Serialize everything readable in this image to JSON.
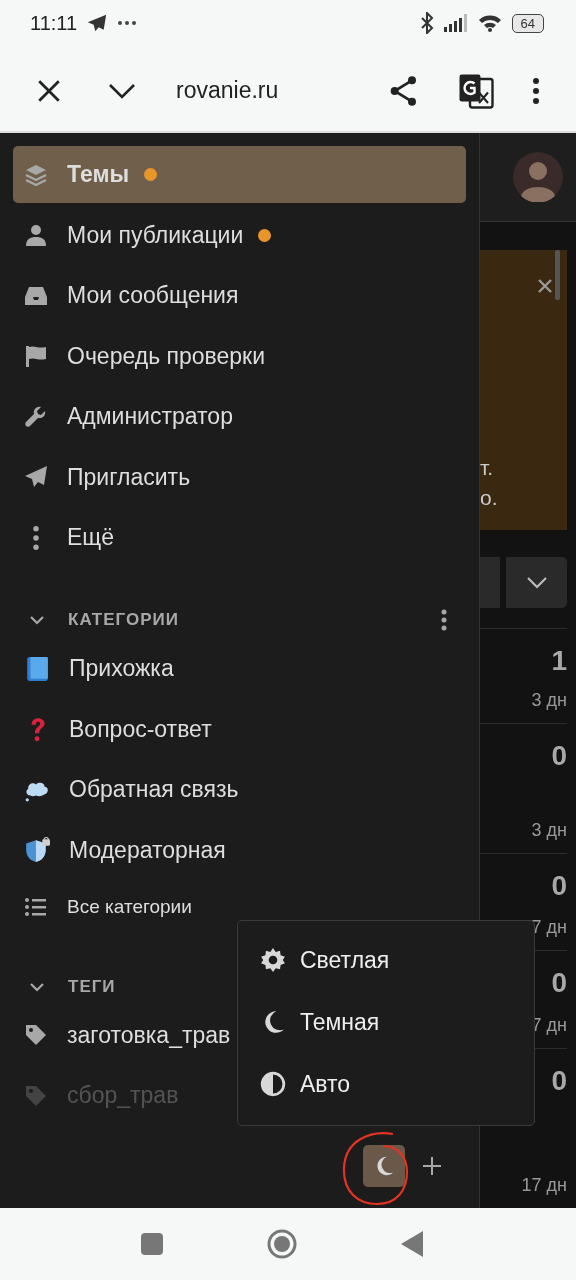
{
  "status_bar": {
    "time": "11:11",
    "battery": "64"
  },
  "browser_bar": {
    "url": "rovanie.ru"
  },
  "sidebar": {
    "nav": [
      {
        "label": "Темы",
        "dot": true,
        "selected": true
      },
      {
        "label": "Мои публикации",
        "dot": true,
        "selected": false
      },
      {
        "label": "Мои сообщения",
        "dot": false,
        "selected": false
      },
      {
        "label": "Очередь проверки",
        "dot": false,
        "selected": false
      },
      {
        "label": "Администратор",
        "dot": false,
        "selected": false
      },
      {
        "label": "Пригласить",
        "dot": false,
        "selected": false
      },
      {
        "label": "Ещё",
        "dot": false,
        "selected": false
      }
    ],
    "categories": {
      "title": "КАТЕГОРИИ",
      "expanded": true,
      "items": [
        {
          "label": "Прихожка"
        },
        {
          "label": "Вопрос-ответ"
        },
        {
          "label": "Обратная связь"
        },
        {
          "label": "Модераторная"
        }
      ],
      "all_label": "Все категории"
    },
    "tags": {
      "title": "ТЕГИ",
      "expanded": true,
      "items": [
        {
          "label": "заготовка_трав",
          "faded": false
        },
        {
          "label": "сбор_трав",
          "faded": true
        }
      ]
    }
  },
  "theme_menu": {
    "options": [
      {
        "label": "Светлая"
      },
      {
        "label": "Темная"
      },
      {
        "label": "Авто"
      }
    ]
  },
  "background": {
    "banner_lines": [
      "т.",
      "о."
    ],
    "rows": [
      {
        "count": "1",
        "age": "3 дн"
      },
      {
        "count": "0",
        "age": "3 дн"
      },
      {
        "count": "0",
        "age": "7 дн"
      },
      {
        "count": "0",
        "age": "7 дн"
      },
      {
        "count": "0",
        "age": "17 дн"
      }
    ]
  }
}
